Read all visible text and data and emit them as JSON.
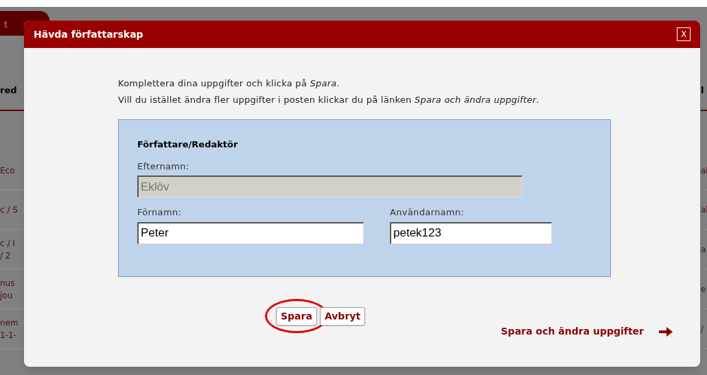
{
  "background_page": {
    "tab": "t",
    "left_header": "red",
    "left_rows": [
      [
        "Eco"
      ],
      [
        "c / S"
      ],
      [
        "c / I",
        "/ 2"
      ],
      [
        "nus",
        "jou"
      ],
      [
        "nem",
        "1-1-"
      ]
    ],
    "right_header": "l",
    "right_rows": [
      [
        "al"
      ],
      [
        "al"
      ],
      [
        "a"
      ],
      [
        "e"
      ],
      [
        "/"
      ]
    ]
  },
  "dialog": {
    "title": "Hävda författarskap",
    "close": "X",
    "intro": [
      "Komplettera dina uppgifter och klicka på *Spara*.",
      "Vill du istället ändra fler uppgifter i posten klickar du på länken *Spara och ändra uppgifter*."
    ],
    "section": {
      "title": "Författare/Redaktör",
      "fields": [
        {
          "label": "Efternamn:",
          "value": "Eklöv",
          "disabled": true
        },
        {
          "label": "Förnamn:",
          "value": "Peter",
          "disabled": false
        },
        {
          "label": "Användarnamn:",
          "value": "petek123",
          "disabled": false
        }
      ]
    },
    "buttons": [
      {
        "label": "Spara",
        "highlighted": true
      },
      {
        "label": "Avbryt",
        "highlighted": false
      }
    ],
    "link": "Spara och ändra uppgifter"
  }
}
